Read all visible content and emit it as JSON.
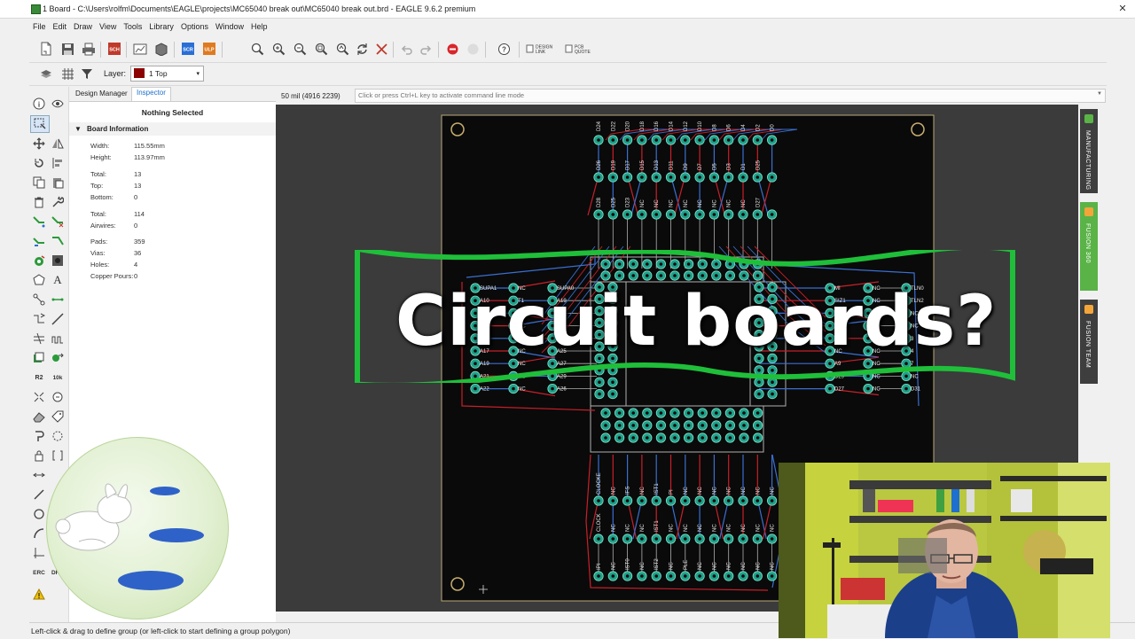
{
  "window": {
    "title": "1 Board - C:\\Users\\rolfm\\Documents\\EAGLE\\projects\\MC65040 break out\\MC65040 break out.brd - EAGLE 9.6.2 premium"
  },
  "menu": [
    "File",
    "Edit",
    "Draw",
    "View",
    "Tools",
    "Library",
    "Options",
    "Window",
    "Help"
  ],
  "toolbar": {
    "design_link": "DESIGN\nLINK",
    "pcb_quote": "PCB\nQUOTE",
    "scr_label": "SCR",
    "ulp_label": "ULP",
    "sch_label": "SCH"
  },
  "layer": {
    "label": "Layer:",
    "selected": "1 Top",
    "color": "#8b0000"
  },
  "panel": {
    "tabs": [
      "Design Manager",
      "Inspector"
    ],
    "active_tab": "Inspector",
    "heading": "Nothing Selected",
    "section": "Board Information",
    "props": [
      {
        "label": "Width:",
        "value": "115.55mm"
      },
      {
        "label": "Height:",
        "value": "113.97mm"
      },
      {
        "label": "Total:",
        "value": "13"
      },
      {
        "label": "Top:",
        "value": "13"
      },
      {
        "label": "Bottom:",
        "value": "0"
      },
      {
        "label": "Total:",
        "value": "114"
      },
      {
        "label": "Airwires:",
        "value": "0"
      },
      {
        "label": "Pads:",
        "value": "359"
      },
      {
        "label": "Vias:",
        "value": "36"
      },
      {
        "label": "Holes:",
        "value": "4"
      },
      {
        "label": "Copper Pours:",
        "value": "0"
      }
    ]
  },
  "coord": "50 mil (4916 2239)",
  "command_placeholder": "Click or press Ctrl+L key to activate command line mode",
  "right_tabs": [
    "MANUFACTURING",
    "FUSION 360",
    "FUSION TEAM"
  ],
  "status": "Left-click & drag to define group (or left-click to start defining a group polygon)",
  "overlay": {
    "caption": "Circuit boards?"
  },
  "left_tool_labels": {
    "r2": "R2",
    "val": "10k",
    "erc": "ERC",
    "drc": "DRC"
  },
  "pcb_labels": {
    "top_row_a": [
      "D24",
      "D22",
      "D20",
      "D18",
      "D16",
      "D14",
      "D12",
      "D10",
      "D8",
      "D6",
      "D4",
      "D2",
      "D0"
    ],
    "top_row_b": [
      "D26",
      "D19",
      "D17",
      "D15",
      "D13",
      "D11",
      "D9",
      "D7",
      "D5",
      "D3",
      "D1",
      "D25"
    ],
    "top_row_c": [
      "D28",
      "D25",
      "D23",
      "NC",
      "NC",
      "NC",
      "NC",
      "NC",
      "NC",
      "NC",
      "NC",
      "D27"
    ],
    "left_col_a": [
      "SUPA1",
      "A10",
      "A12",
      "A14",
      "A16",
      "A17",
      "A19",
      "A21",
      "A22"
    ],
    "left_col_b": [
      "NC",
      "T1",
      "NC",
      "NC",
      "NC",
      "NC",
      "NC",
      "NC",
      "NC"
    ],
    "left_col_c": [
      "SUPA0",
      "A19",
      "A18",
      "A20",
      "A23",
      "A25",
      "A27",
      "A29",
      "A26"
    ],
    "right_col_a": [
      "MI",
      "SIZ1",
      "NC",
      "NC",
      "NC",
      "NC",
      "A9",
      "D29",
      "D27"
    ],
    "right_col_b": [
      "NC",
      "NC",
      "NC",
      "NC",
      "A2",
      "NC",
      "NC",
      "NC",
      "NC"
    ],
    "right_col_c": [
      "TLN0",
      "TLN2",
      "NC",
      "NC",
      "3",
      "4",
      "7",
      "NC",
      "D31"
    ],
    "bottom_row_a": [
      "CLOCKE",
      "NC",
      "IFS",
      "NC",
      "IST1",
      "PI",
      "NC",
      "NC",
      "NC",
      "NC",
      "NC",
      "NC",
      "NC"
    ],
    "bottom_row_b": [
      "CLOCK",
      "NC",
      "NC",
      "NC",
      "IST1",
      "NC",
      "NC",
      "NC",
      "NC",
      "NC",
      "NC",
      "NC",
      "NC"
    ],
    "bottom_row_c": [
      "IPI",
      "NC",
      "IST0",
      "NC",
      "IST2",
      "NC",
      "PLE",
      "NC",
      "NC",
      "NC",
      "NC",
      "NC",
      "NC"
    ]
  }
}
